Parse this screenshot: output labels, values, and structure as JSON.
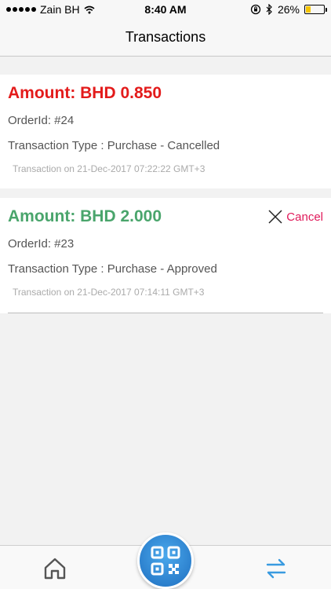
{
  "status_bar": {
    "carrier": "Zain BH",
    "time": "8:40 AM",
    "battery": "26%",
    "battery_level": 0.26
  },
  "nav": {
    "title": "Transactions"
  },
  "transactions": [
    {
      "amount": "Amount: BHD 0.850",
      "order_id": "OrderId: #24",
      "type": "Transaction Type : Purchase - Cancelled",
      "timestamp": "Transaction on 21-Dec-2017 07:22:22 GMT+3",
      "amount_color": "#e31b1b"
    },
    {
      "amount": "Amount: BHD 2.000",
      "order_id": "OrderId: #23",
      "type": "Transaction Type : Purchase - Approved",
      "timestamp": "Transaction on 21-Dec-2017 07:14:11 GMT+3",
      "amount_color": "#4aa56c",
      "cancel_label": "Cancel"
    }
  ],
  "tab_bar": {
    "items": [
      {
        "icon": "home-icon",
        "color": "#555555"
      },
      {
        "icon": "qr-scan-icon",
        "color": "#2a86d8"
      },
      {
        "icon": "transfer-arrows-icon",
        "color": "#3a9be0"
      }
    ]
  }
}
